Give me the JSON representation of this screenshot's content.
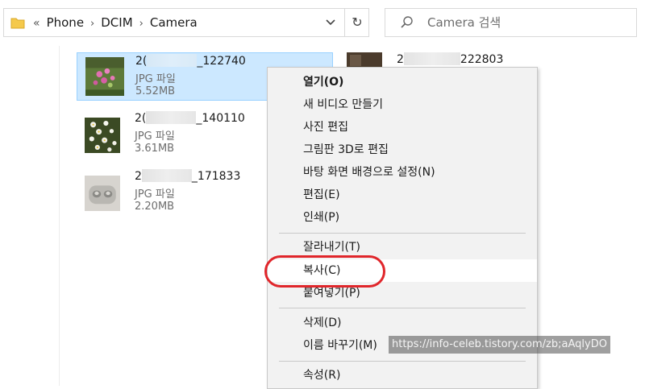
{
  "address_bar": {
    "lead": "«",
    "crumbs": [
      "Phone",
      "DCIM",
      "Camera"
    ],
    "dropdown": "⌄",
    "refresh": "↻"
  },
  "search": {
    "placeholder": "Camera 검색"
  },
  "files": [
    {
      "name_prefix": "2(",
      "name_suffix": "_122740",
      "type": "JPG 파일",
      "size": "5.52MB",
      "selected": true
    },
    {
      "name_prefix": "2(",
      "name_suffix": "_140110",
      "type": "JPG 파일",
      "size": "3.61MB",
      "selected": false
    },
    {
      "name_prefix": "2",
      "name_suffix": "_171833",
      "type": "JPG 파일",
      "size": "2.20MB",
      "selected": false
    }
  ],
  "file_right": {
    "name_prefix": "2",
    "name_suffix": "222803"
  },
  "context_menu": {
    "items": [
      {
        "label": "열기(O)",
        "bold": true
      },
      {
        "label": "새 비디오 만들기"
      },
      {
        "label": "사진 편집"
      },
      {
        "label": "그림판 3D로 편집"
      },
      {
        "label": "바탕 화면 배경으로 설정(N)"
      },
      {
        "label": "편집(E)"
      },
      {
        "label": "인쇄(P)"
      },
      {
        "label": "잘라내기(T)"
      },
      {
        "label": "복사(C)",
        "highlighted": true
      },
      {
        "label": "붙여넣기(P)"
      },
      {
        "label": "삭제(D)"
      },
      {
        "label": "이름 바꾸기(M)"
      },
      {
        "label": "속성(R)"
      }
    ]
  },
  "watermark": "https://info-celeb.tistory.com/zb;aAqlyDO",
  "colors": {
    "selection": "#cce8ff",
    "selection_border": "#99d1ff",
    "annotation": "#e0262b"
  }
}
